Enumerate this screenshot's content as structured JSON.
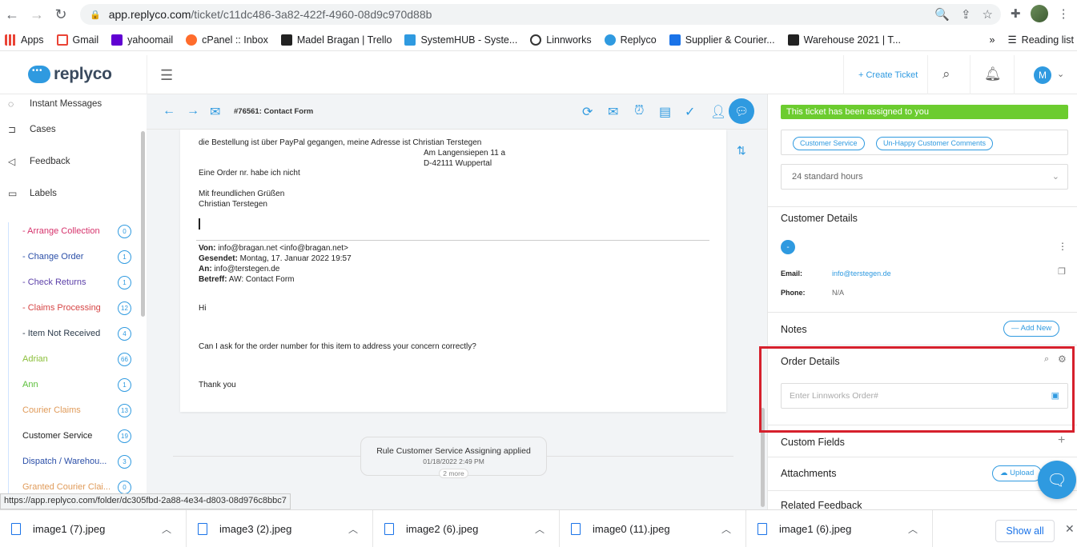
{
  "browser": {
    "url_host": "app.replyco.com",
    "url_path": "/ticket/c11dc486-3a82-422f-4960-08d9c970d88b",
    "bookmarks": [
      {
        "label": "Apps",
        "icon": "apps-grid-icon",
        "color": "#ea4335"
      },
      {
        "label": "Gmail",
        "icon": "gmail-icon",
        "color": "#ea4335"
      },
      {
        "label": "yahoomail",
        "icon": "yahoo-icon",
        "color": "#6001d2"
      },
      {
        "label": "cPanel :: Inbox",
        "icon": "cpanel-icon",
        "color": "#ff6c2c"
      },
      {
        "label": "Madel Bragan | Trello",
        "icon": "trello-icon",
        "color": "#222222"
      },
      {
        "label": "SystemHUB - Syste...",
        "icon": "systemhub-icon",
        "color": "#2f9ae0"
      },
      {
        "label": "Linnworks",
        "icon": "linnworks-icon",
        "color": "#333333"
      },
      {
        "label": "Replyco",
        "icon": "replyco-icon",
        "color": "#2f9ae0"
      },
      {
        "label": "Supplier & Courier...",
        "icon": "sheet-icon",
        "color": "#1a73e8"
      },
      {
        "label": "Warehouse 2021 | T...",
        "icon": "trello-icon",
        "color": "#222222"
      }
    ],
    "reading_list": "Reading list"
  },
  "header": {
    "logo_text": "replyco",
    "create_ticket": "+ Create Ticket",
    "avatar_initial": "M"
  },
  "sidebar": {
    "main_items": [
      {
        "label": "Instant Messages",
        "icon": "chat-bubble-icon"
      },
      {
        "label": "Cases",
        "icon": "cases-icon"
      },
      {
        "label": "Feedback",
        "icon": "megaphone-icon"
      },
      {
        "label": "Labels",
        "icon": "folder-icon"
      }
    ],
    "labels": [
      {
        "label": "- Arrange Collection",
        "count": "0",
        "color": "#d6336c"
      },
      {
        "label": "- Change Order",
        "count": "1",
        "color": "#2b4fa8"
      },
      {
        "label": "- Check Returns",
        "count": "1",
        "color": "#5b3fa8"
      },
      {
        "label": "- Claims Processing",
        "count": "12",
        "color": "#d64545"
      },
      {
        "label": "- Item Not Received",
        "count": "4",
        "color": "#2b3a4a"
      },
      {
        "label": "Adrian",
        "count": "66",
        "color": "#8bbf3a"
      },
      {
        "label": "Ann",
        "count": "1",
        "color": "#5bbf3a"
      },
      {
        "label": "Courier Claims",
        "count": "13",
        "color": "#e09b5a"
      },
      {
        "label": "Customer Service",
        "count": "19",
        "color": "#222222"
      },
      {
        "label": "Dispatch / Warehou...",
        "count": "3",
        "color": "#2b4fa8"
      },
      {
        "label": "Granted Courier Clai...",
        "count": "0",
        "color": "#e09b5a"
      }
    ]
  },
  "ticket": {
    "title": "#76561: Contact Form",
    "email_lines": [
      "die Bestellung ist über PayPal gegangen, meine Adresse ist Christian Terstegen",
      "Am Langensiepen 11 a",
      "D-42111 Wuppertal",
      "Eine Order nr. habe ich nicht",
      "Mit freundlichen Grüßen",
      "Christian Terstegen"
    ],
    "quote": {
      "from_label": "Von:",
      "from_value": " info@bragan.net <info@bragan.net>",
      "sent_label": "Gesendet:",
      "sent_value": " Montag, 17. Januar 2022 19:57",
      "to_label": "An:",
      "to_value": " info@terstegen.de",
      "subject_label": "Betreff:",
      "subject_value": " AW: Contact Form"
    },
    "reply_lines": [
      "Hi",
      "Can I ask for the order number for this item to address your concern correctly?",
      "Thank you"
    ],
    "rule": {
      "title": "Rule Customer Service Assigning applied",
      "date": "01/18/2022 2:49 PM",
      "more": "2 more"
    }
  },
  "right_panel": {
    "assigned_text": "This ticket has been assigned to you",
    "assigned_color": "#6ccc2f",
    "tags": [
      "Customer Service",
      "Un-Happy Customer Comments"
    ],
    "sla": "24 standard hours",
    "customer_details_title": "Customer Details",
    "customer_initial": "-",
    "email_label": "Email:",
    "email_value": "info@terstegen.de",
    "phone_label": "Phone:",
    "phone_value": "N/A",
    "notes_title": "Notes",
    "add_new": "— Add New",
    "order_details_title": "Order Details",
    "order_placeholder": "Enter Linnworks Order#",
    "custom_fields_title": "Custom Fields",
    "attachments_title": "Attachments",
    "upload": "Upload",
    "related_feedback_title": "Related Feedback"
  },
  "status_url": "https://app.replyco.com/folder/dc305fbd-2a88-4e34-d803-08d976c8bbc7",
  "downloads": {
    "items": [
      "image1 (7).jpeg",
      "image3 (2).jpeg",
      "image2 (6).jpeg",
      "image0 (11).jpeg",
      "image1 (6).jpeg"
    ],
    "show_all": "Show all"
  }
}
